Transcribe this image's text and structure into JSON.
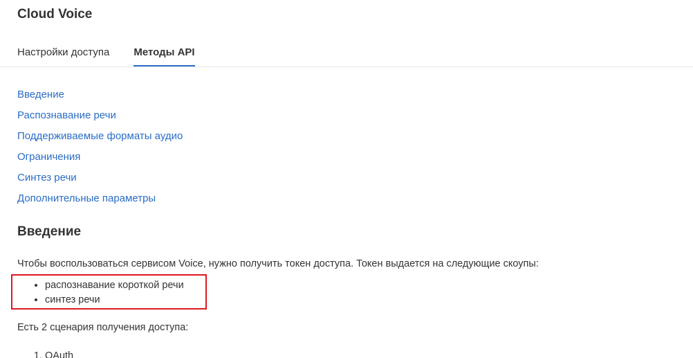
{
  "app": {
    "title": "Cloud Voice"
  },
  "tabs": [
    {
      "label": "Настройки доступа",
      "active": false
    },
    {
      "label": "Методы API",
      "active": true
    }
  ],
  "toc": [
    {
      "label": "Введение"
    },
    {
      "label": "Распознавание речи"
    },
    {
      "label": "Поддерживаемые форматы аудио"
    },
    {
      "label": "Ограничения"
    },
    {
      "label": "Синтез речи"
    },
    {
      "label": "Дополнительные параметры"
    }
  ],
  "content": {
    "section_title": "Введение",
    "intro_text": "Чтобы воспользоваться сервисом Voice, нужно получить токен доступа. Токен выдается на следующие скоупы:",
    "scopes": [
      "распознавание короткой речи",
      "синтез речи"
    ],
    "scenarios_text": "Есть 2 сценария получения доступа:",
    "methods": [
      "OAuth"
    ]
  },
  "colors": {
    "link": "#2a6dc6",
    "highlight": "#e0161f",
    "text": "#333333",
    "tab_underline": "#2a6dc6"
  }
}
